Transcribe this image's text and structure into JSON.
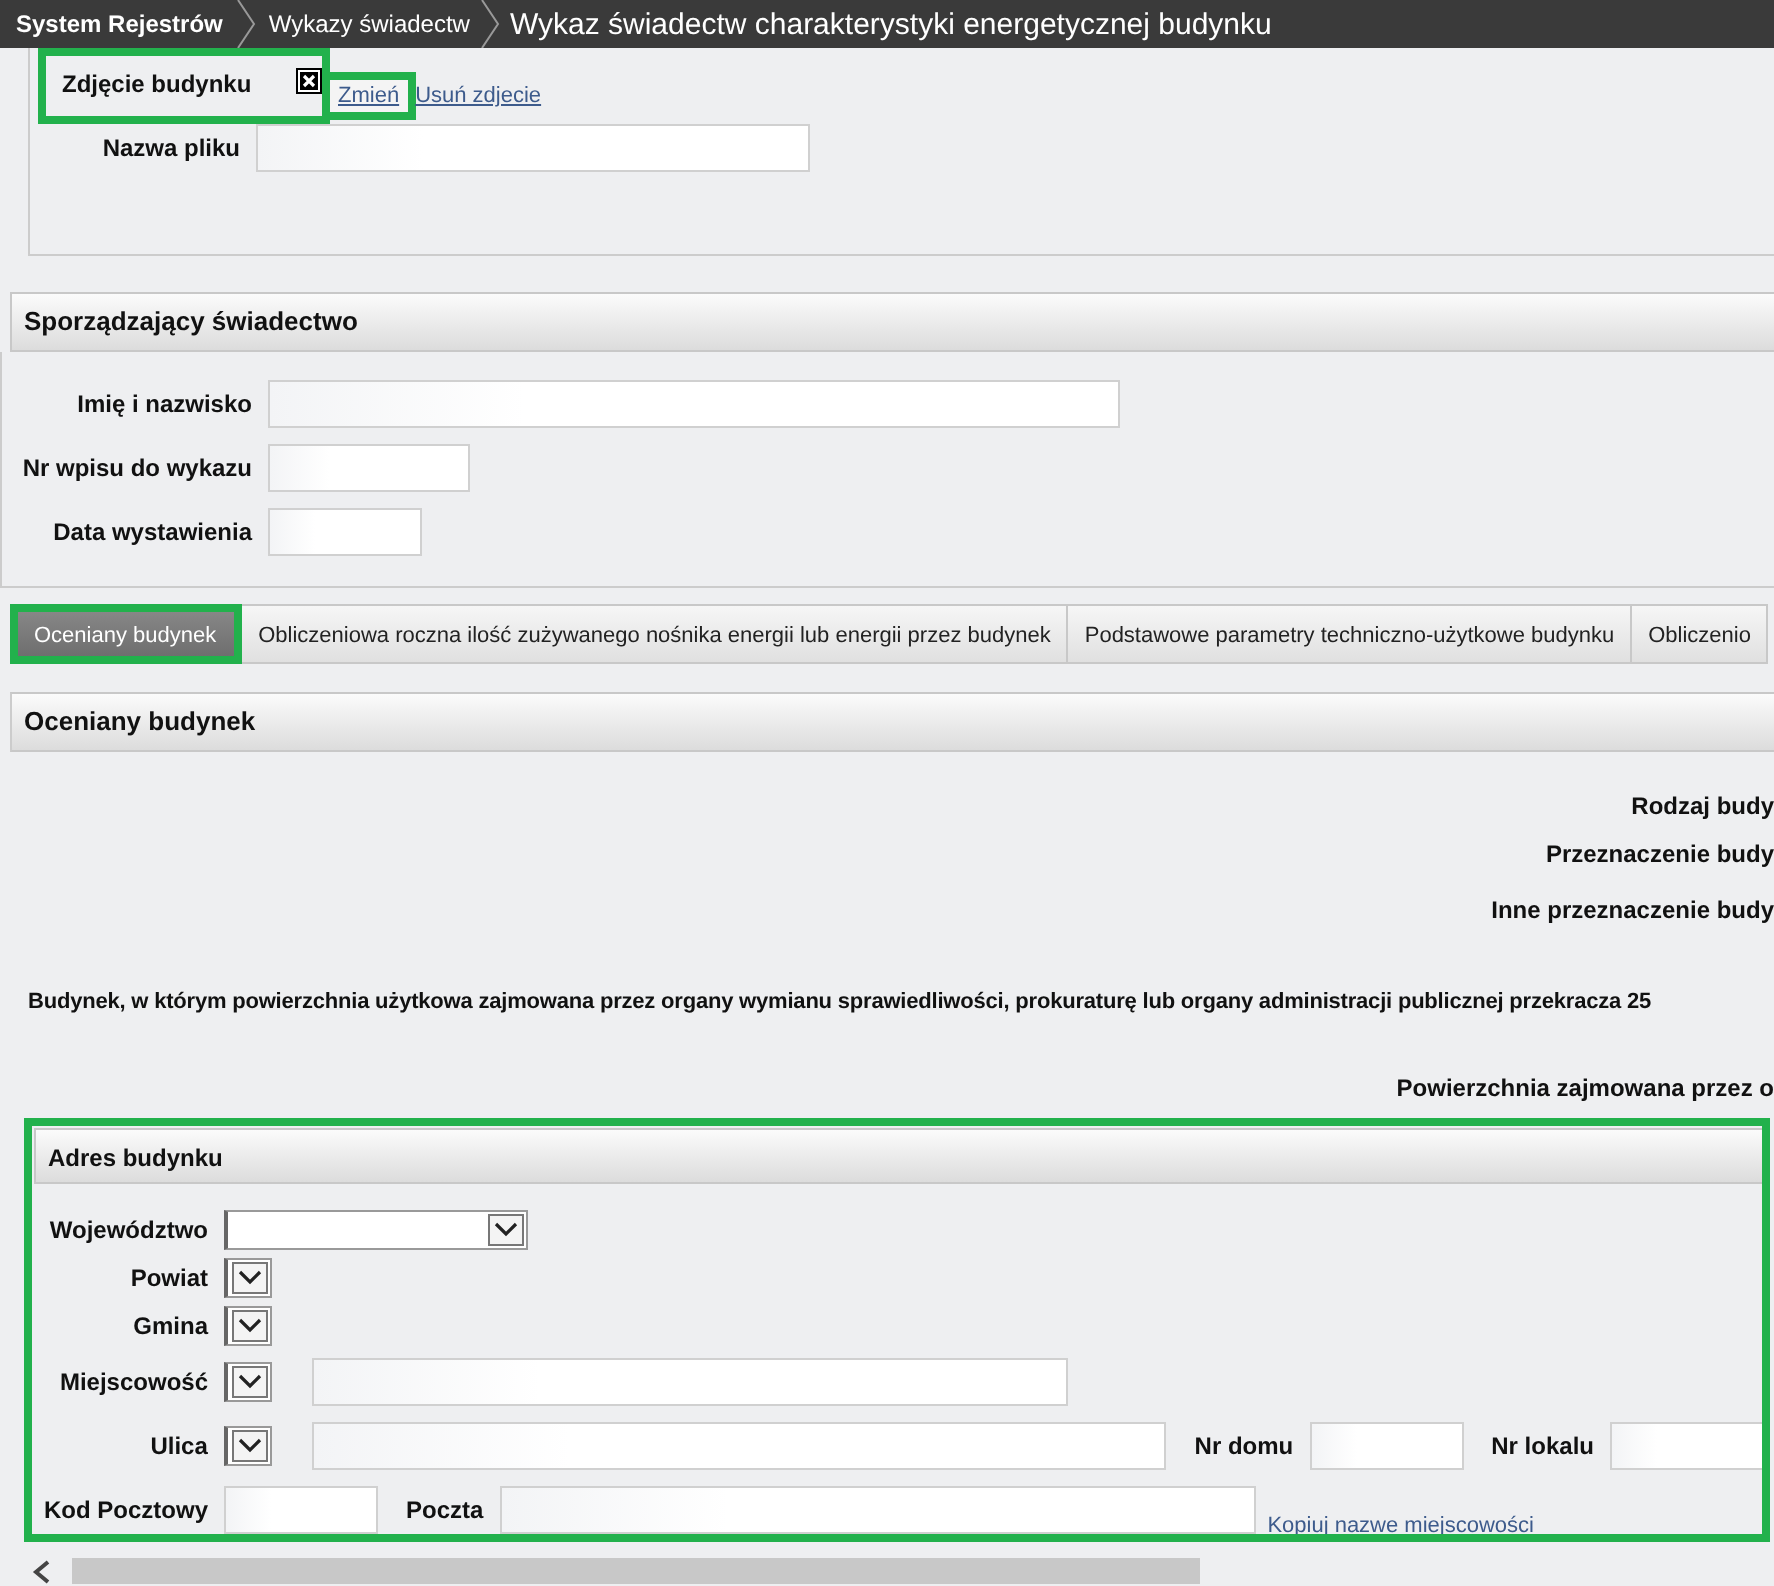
{
  "breadcrumbs": [
    {
      "label": "System Rejestrów",
      "kind": "root"
    },
    {
      "label": "Wykazy świadectw",
      "kind": "link"
    },
    {
      "label": "Wykaz świadectw charakterystyki energetycznej budynku",
      "kind": "current"
    }
  ],
  "photo": {
    "label": "Zdjęcie budynku",
    "highlighted": true,
    "links": [
      {
        "label": "Zmień",
        "highlighted": true
      },
      {
        "label": "Usuń zdjecie",
        "highlighted": false
      }
    ],
    "file_label": "Nazwa pliku"
  },
  "issuer": {
    "title": "Sporządzający świadectwo",
    "fields": [
      {
        "label": "Imię i nazwisko",
        "kind": "long"
      },
      {
        "label": "Nr wpisu do wykazu",
        "kind": "medium"
      },
      {
        "label": "Data wystawienia",
        "kind": "short"
      }
    ]
  },
  "tabs": [
    {
      "label": "Oceniany budynek",
      "selected": true,
      "highlighted": true
    },
    {
      "label": "Obliczeniowa roczna ilość zużywanego nośnika energii lub energii przez budynek",
      "selected": false,
      "highlighted": false
    },
    {
      "label": "Podstawowe parametry techniczno-użytkowe budynku",
      "selected": false,
      "highlighted": false
    },
    {
      "label": "Obliczenio",
      "selected": false,
      "highlighted": false
    }
  ],
  "building": {
    "title": "Oceniany budynek",
    "labels": [
      {
        "text": "Rodzaj budy",
        "kind": "right"
      },
      {
        "text": "Przeznaczenie budy",
        "kind": "right"
      },
      {
        "text": "Inne przeznaczenie budy",
        "kind": "right"
      },
      {
        "text": "Budynek, w którym powierzchnia użytkowa zajmowana przez organy wymianu sprawiedliwości, prokuraturę lub organy administracji publicznej przekracza 25",
        "kind": "sentence"
      },
      {
        "text": "Powierzchnia zajmowana przez o",
        "kind": "right"
      }
    ]
  },
  "address": {
    "title": "Adres budynku",
    "highlighted": true,
    "rows": [
      {
        "label": "Województwo",
        "controls": [
          {
            "kind": "dropdown_wide"
          }
        ]
      },
      {
        "label": "Powiat",
        "controls": [
          {
            "kind": "dropdown"
          }
        ]
      },
      {
        "label": "Gmina",
        "controls": [
          {
            "kind": "dropdown"
          }
        ]
      },
      {
        "label": "Miejscowość",
        "controls": [
          {
            "kind": "dropdown"
          },
          {
            "kind": "text"
          }
        ]
      },
      {
        "label": "Ulica",
        "controls": [
          {
            "kind": "dropdown"
          },
          {
            "kind": "text_long"
          },
          {
            "kind": "label",
            "text": "Nr domu"
          },
          {
            "kind": "text_short"
          },
          {
            "kind": "label",
            "text": "Nr lokalu"
          },
          {
            "kind": "text_short"
          }
        ]
      },
      {
        "label": "Kod Pocztowy",
        "controls": [
          {
            "kind": "text_short"
          },
          {
            "kind": "label",
            "text": "Poczta"
          },
          {
            "kind": "text"
          },
          {
            "kind": "link",
            "text": "Kopiuj nazwe miejscowości"
          }
        ]
      }
    ]
  }
}
